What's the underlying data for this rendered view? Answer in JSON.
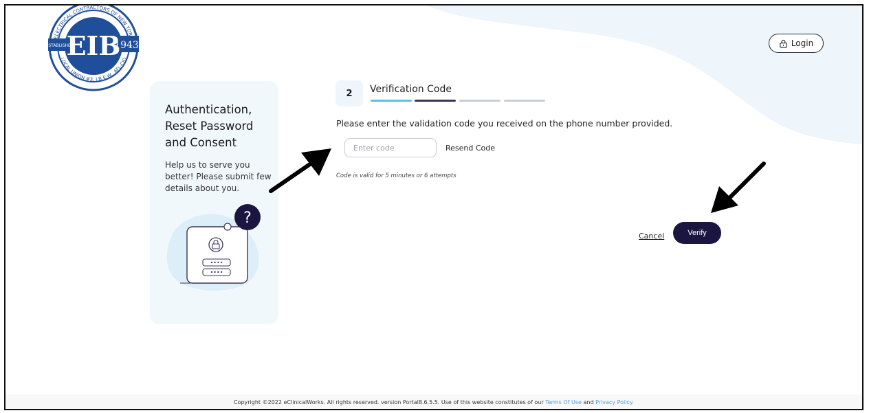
{
  "header": {
    "logo": {
      "top_text": "ELECTRICAL CONTRACTORS OF NEW YORK",
      "bottom_text": "LOCAL UNION #3, I.B.E.W., AFL-CIO",
      "left_text": "ESTABLISHED",
      "right_text": "1943",
      "monogram": "EIB",
      "color": "#1f4e9a"
    },
    "login_label": "Login"
  },
  "side_card": {
    "title": "Authentication, Reset Password and Consent",
    "text": "Help us to serve you better! Please submit few details about you.",
    "illustration_badge": "?"
  },
  "form": {
    "step_number": "2",
    "step_label": "Verification Code",
    "progress_colors": [
      "#5bc0de",
      "#3b3359",
      "#c7ced6",
      "#c7ced6"
    ],
    "prompt": "Please enter the validation code you received on the phone number provided.",
    "code_input": {
      "value": "",
      "placeholder": "Enter code"
    },
    "resend_label": "Resend Code",
    "validity_note": "Code is valid for 5 minutes or 6 attempts",
    "cancel_label": "Cancel",
    "verify_label": "Verify"
  },
  "footer": {
    "text": "Copyright ©2022 eClinicalWorks. All rights reserved. version  Portal8.6.5.5.  Use of this website constitutes of our",
    "terms_label": "Terms Of Use",
    "and_text": "and",
    "privacy_label": "Privacy Policy."
  },
  "colors": {
    "accent_dark": "#1b1640",
    "background_blob": "#eef6fb",
    "link": "#4a9fd8"
  }
}
